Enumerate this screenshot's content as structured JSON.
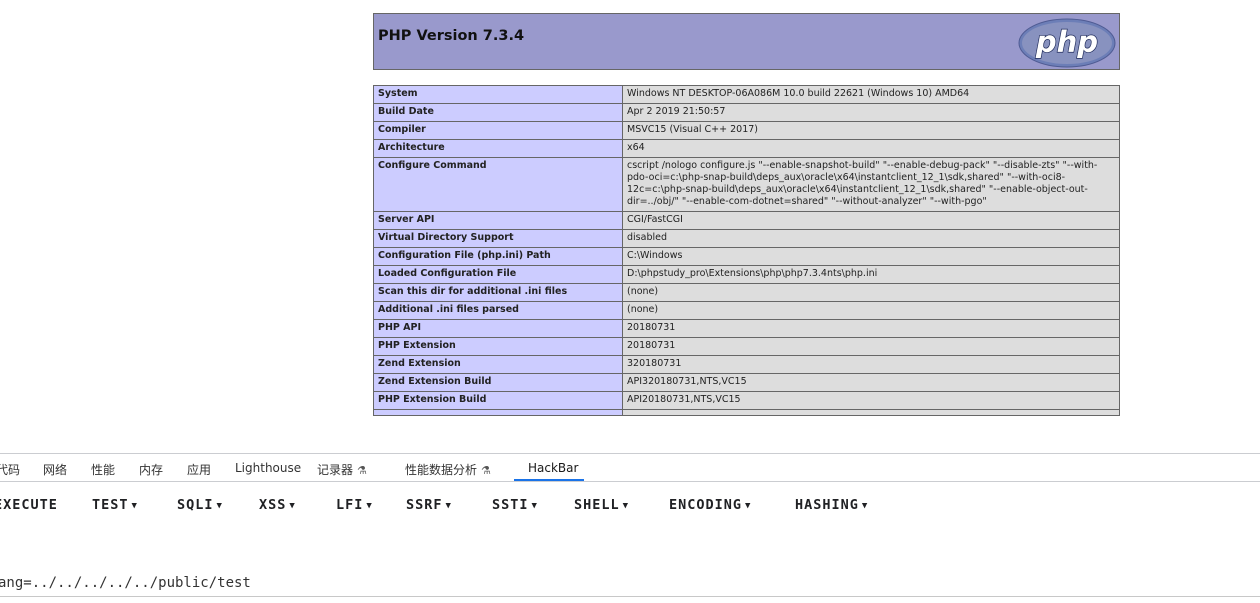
{
  "php": {
    "title": "PHP Version 7.3.4",
    "logo_text": "php",
    "rows": [
      {
        "key": "System",
        "value": "Windows NT DESKTOP-06A086M 10.0 build 22621 (Windows 10) AMD64"
      },
      {
        "key": "Build Date",
        "value": "Apr 2 2019 21:50:57"
      },
      {
        "key": "Compiler",
        "value": "MSVC15 (Visual C++ 2017)"
      },
      {
        "key": "Architecture",
        "value": "x64"
      },
      {
        "key": "Configure Command",
        "value": "cscript /nologo configure.js \"--enable-snapshot-build\" \"--enable-debug-pack\" \"--disable-zts\" \"--with-pdo-oci=c:\\php-snap-build\\deps_aux\\oracle\\x64\\instantclient_12_1\\sdk,shared\" \"--with-oci8-12c=c:\\php-snap-build\\deps_aux\\oracle\\x64\\instantclient_12_1\\sdk,shared\" \"--enable-object-out-dir=../obj/\" \"--enable-com-dotnet=shared\" \"--without-analyzer\" \"--with-pgo\""
      },
      {
        "key": "Server API",
        "value": "CGI/FastCGI"
      },
      {
        "key": "Virtual Directory Support",
        "value": "disabled"
      },
      {
        "key": "Configuration File (php.ini) Path",
        "value": "C:\\Windows"
      },
      {
        "key": "Loaded Configuration File",
        "value": "D:\\phpstudy_pro\\Extensions\\php\\php7.3.4nts\\php.ini"
      },
      {
        "key": "Scan this dir for additional .ini files",
        "value": "(none)"
      },
      {
        "key": "Additional .ini files parsed",
        "value": "(none)"
      },
      {
        "key": "PHP API",
        "value": "20180731"
      },
      {
        "key": "PHP Extension",
        "value": "20180731"
      },
      {
        "key": "Zend Extension",
        "value": "320180731"
      },
      {
        "key": "Zend Extension Build",
        "value": "API320180731,NTS,VC15"
      },
      {
        "key": "PHP Extension Build",
        "value": "API20180731,NTS,VC15"
      },
      {
        "key": "",
        "value": ""
      }
    ]
  },
  "devtools": {
    "tabs": [
      "代码",
      "网络",
      "性能",
      "内存",
      "应用",
      "Lighthouse",
      "记录器",
      "性能数据分析",
      "HackBar"
    ],
    "active_tab": "HackBar",
    "experimental_icon": "flask-icon"
  },
  "hackbar": {
    "menu": [
      "EXECUTE",
      "TEST",
      "SQLI",
      "XSS",
      "LFI",
      "SSRF",
      "SSTI",
      "SHELL",
      "ENCODING",
      "HASHING"
    ],
    "url_value": "ang=../../../../../public/test"
  },
  "colors": {
    "php_header": "#9999cc",
    "php_key_cell": "#ccccff",
    "php_value_cell": "#dddddd",
    "active_tab_underline": "#1a73e8"
  }
}
